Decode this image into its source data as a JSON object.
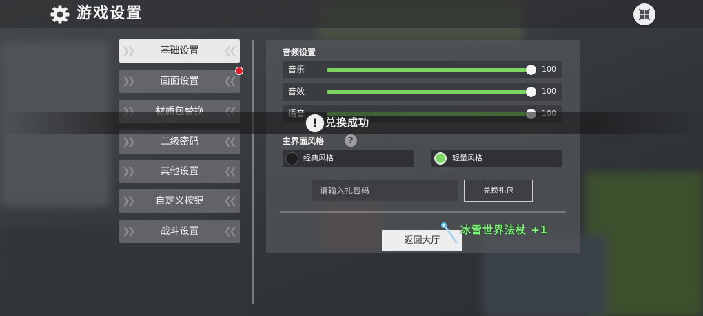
{
  "header": {
    "title": "游戏设置"
  },
  "tabs": [
    {
      "label": "基础设置",
      "active": true
    },
    {
      "label": "画面设置",
      "active": false,
      "badge": true
    },
    {
      "label": "材质包替换",
      "active": false
    },
    {
      "label": "二级密码",
      "active": false
    },
    {
      "label": "其他设置",
      "active": false
    },
    {
      "label": "自定义按键",
      "active": false
    },
    {
      "label": "战斗设置",
      "active": false
    }
  ],
  "audio": {
    "title": "音频设置",
    "sliders": [
      {
        "label": "音乐",
        "value": "100",
        "level": 1.0
      },
      {
        "label": "音效",
        "value": "100",
        "level": 1.0
      },
      {
        "label": "语音",
        "value": "100",
        "level": 1.0
      }
    ]
  },
  "style": {
    "title": "主界面风格",
    "help": "?",
    "options": [
      {
        "label": "经典风格",
        "selected": false
      },
      {
        "label": "轻量风格",
        "selected": true
      }
    ]
  },
  "gift": {
    "placeholder": "请输入礼包码",
    "button_label": "兑换礼包"
  },
  "back_button": "返回大厅",
  "toast": {
    "icon": "!",
    "text": "兑换成功"
  },
  "reward": {
    "text": "冰雪世界法杖 +1"
  },
  "colors": {
    "accent": "#7ed662",
    "reward_text": "#7ff07a",
    "badge": "#e0212b"
  }
}
